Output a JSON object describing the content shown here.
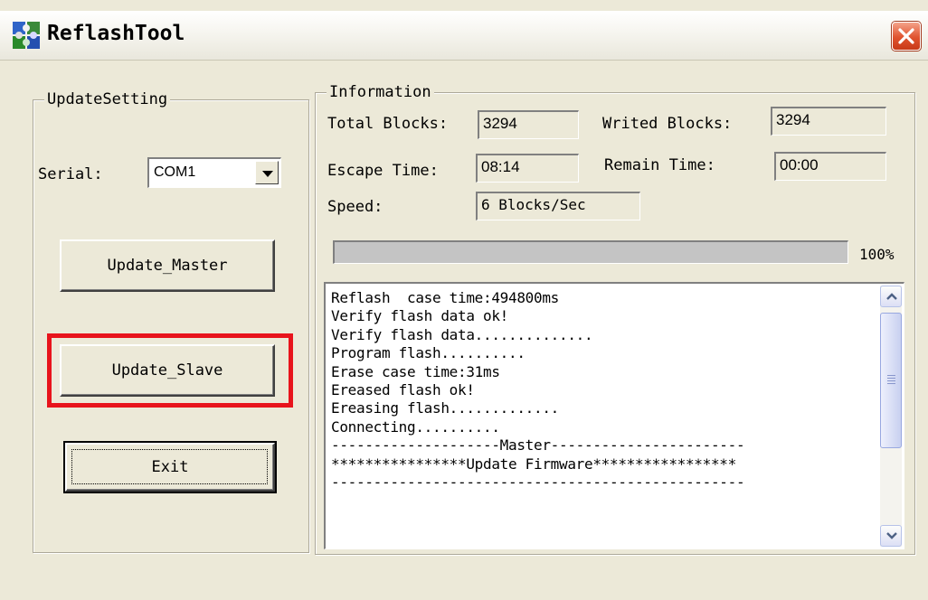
{
  "window": {
    "title": "ReflashTool",
    "icon": "app-puzzle-icon",
    "close_icon": "close-icon",
    "close_color": "#e0532f"
  },
  "update_setting": {
    "group_label": "UpdateSetting",
    "serial_label": "Serial:",
    "serial_value": "COM1",
    "update_master_label": "Update_Master",
    "update_slave_label": "Update_Slave",
    "exit_label": "Exit",
    "highlight_color": "#e8141c"
  },
  "information": {
    "group_label": "Information",
    "total_blocks_label": "Total Blocks:",
    "total_blocks_value": "3294",
    "writed_blocks_label": "Writed Blocks:",
    "writed_blocks_value": "3294",
    "escape_time_label": "Escape Time:",
    "escape_time_value": "08:14",
    "remain_time_label": "Remain Time:",
    "remain_time_value": "00:00",
    "speed_label": "Speed:",
    "speed_value": "6 Blocks/Sec",
    "progress_percent": 100,
    "progress_label": "100%"
  },
  "log": {
    "lines": [
      "Reflash  case time:494800ms",
      "Verify flash data ok!",
      "Verify flash data..............",
      "Program flash..........",
      "Erase case time:31ms",
      "Ereased flash ok!",
      "Ereasing flash.............",
      "Connecting..........",
      "--------------------Master-----------------------",
      "****************Update Firmware*****************",
      "-------------------------------------------------"
    ]
  }
}
